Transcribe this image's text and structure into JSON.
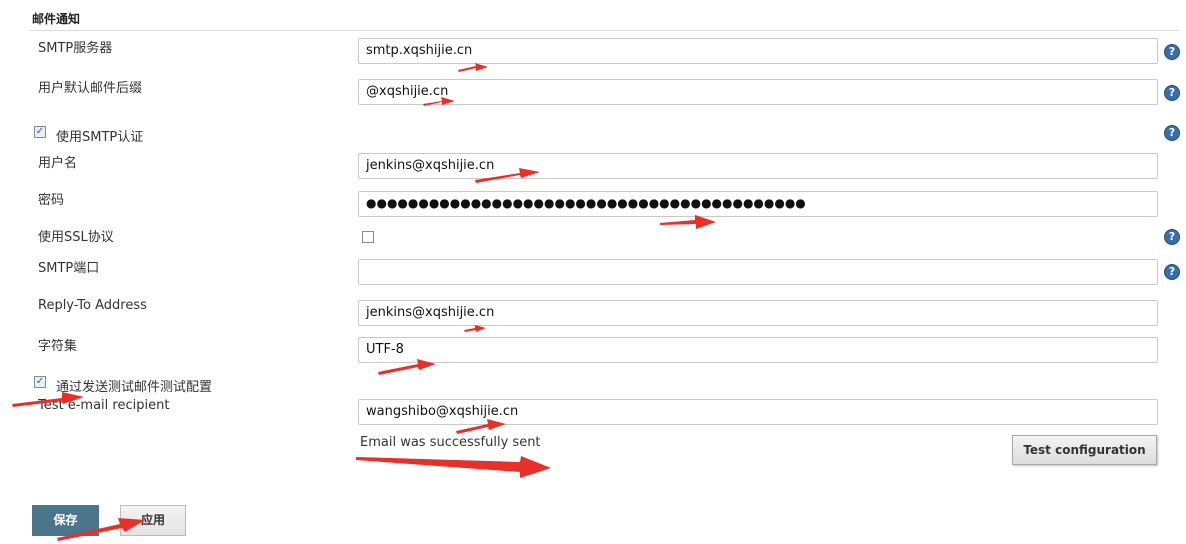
{
  "section": {
    "title": "邮件通知"
  },
  "fields": {
    "smtp_server": {
      "label": "SMTP服务器",
      "value": "smtp.xqshijie.cn"
    },
    "default_suffix": {
      "label": "用户默认邮件后缀",
      "value": "@xqshijie.cn"
    },
    "use_smtp_auth": {
      "label": "使用SMTP认证",
      "checked": true
    },
    "username": {
      "label": "用户名",
      "value": "jenkins@xqshijie.cn"
    },
    "password": {
      "label": "密码",
      "value": "●●●●●●●●●●●●●●●●●●●●●●●●●●●●●●●●●●●●●●●●●●"
    },
    "use_ssl": {
      "label": "使用SSL协议",
      "checked": false
    },
    "smtp_port": {
      "label": "SMTP端口",
      "value": ""
    },
    "reply_to": {
      "label": "Reply-To Address",
      "value": "jenkins@xqshijie.cn"
    },
    "charset": {
      "label": "字符集",
      "value": "UTF-8"
    },
    "send_test": {
      "label": "通过发送测试邮件测试配置",
      "checked": true
    },
    "test_recipient": {
      "label": "Test e-mail recipient",
      "value": "wangshibo@xqshijie.cn"
    }
  },
  "status": {
    "message": "Email was successfully sent"
  },
  "buttons": {
    "test_config": "Test configuration",
    "save": "保存",
    "apply": "应用"
  },
  "icons": {
    "help": "help-icon",
    "checkbox_checked_glyph": "✓",
    "annotation_arrow_color": "#e8302a"
  },
  "colors": {
    "save_button": "#4b758b",
    "help_icon": "#3b6ea5"
  }
}
